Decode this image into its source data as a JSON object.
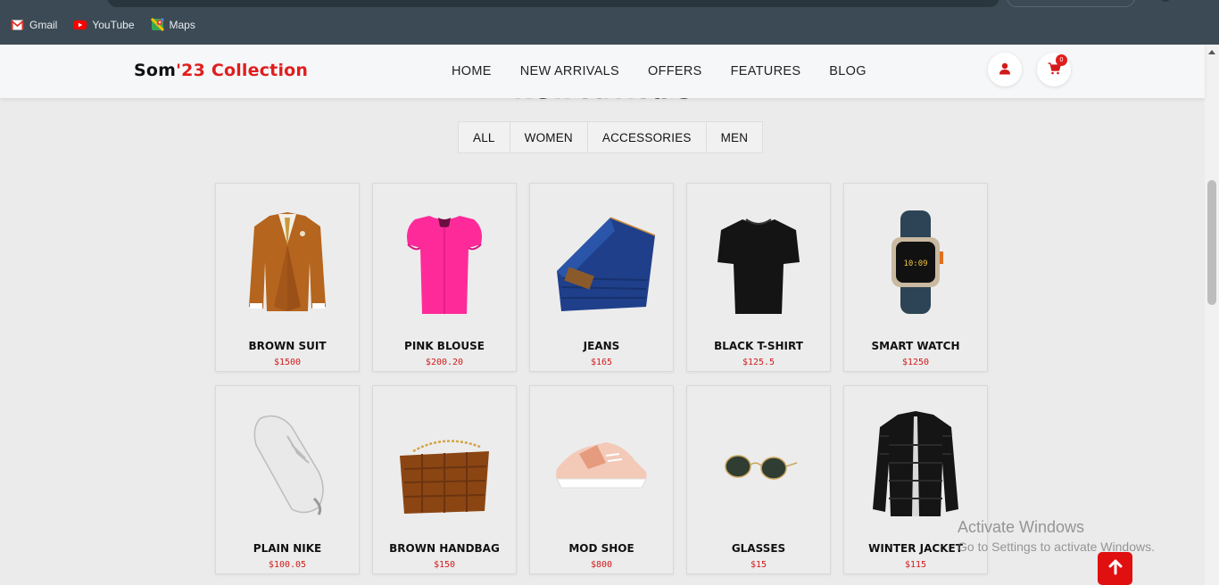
{
  "bookmarks": [
    {
      "label": "Gmail",
      "icon": "gmail-icon"
    },
    {
      "label": "YouTube",
      "icon": "youtube-icon"
    },
    {
      "label": "Maps",
      "icon": "maps-icon"
    }
  ],
  "header": {
    "logo_main": "Som",
    "logo_accent": "'23 Collection",
    "nav": [
      "HOME",
      "NEW ARRIVALS",
      "OFFERS",
      "FEATURES",
      "BLOG"
    ],
    "cart_count": "0",
    "icons": [
      "user-icon",
      "cart-icon"
    ]
  },
  "section": {
    "title": "New Arrivals",
    "filters": [
      "ALL",
      "WOMEN",
      "ACCESSORIES",
      "MEN"
    ]
  },
  "products": [
    {
      "name": "BROWN SUIT",
      "price": "$1500"
    },
    {
      "name": "PINK BLOUSE",
      "price": "$200.20"
    },
    {
      "name": "JEANS",
      "price": "$165"
    },
    {
      "name": "BLACK T-SHIRT",
      "price": "$125.5"
    },
    {
      "name": "SMART WATCH",
      "price": "$1250"
    },
    {
      "name": "PLAIN NIKE",
      "price": "$100.05"
    },
    {
      "name": "BROWN HANDBAG",
      "price": "$150"
    },
    {
      "name": "MOD SHOE",
      "price": "$800"
    },
    {
      "name": "GLASSES",
      "price": "$15"
    },
    {
      "name": "WINTER JACKET",
      "price": "$115"
    }
  ],
  "watermark": {
    "line1": "Activate Windows",
    "line2": "Go to Settings to activate Windows."
  },
  "colors": {
    "accent": "#e01e1e",
    "chrome": "#3c4a55",
    "page_bg": "#ebebeb"
  }
}
